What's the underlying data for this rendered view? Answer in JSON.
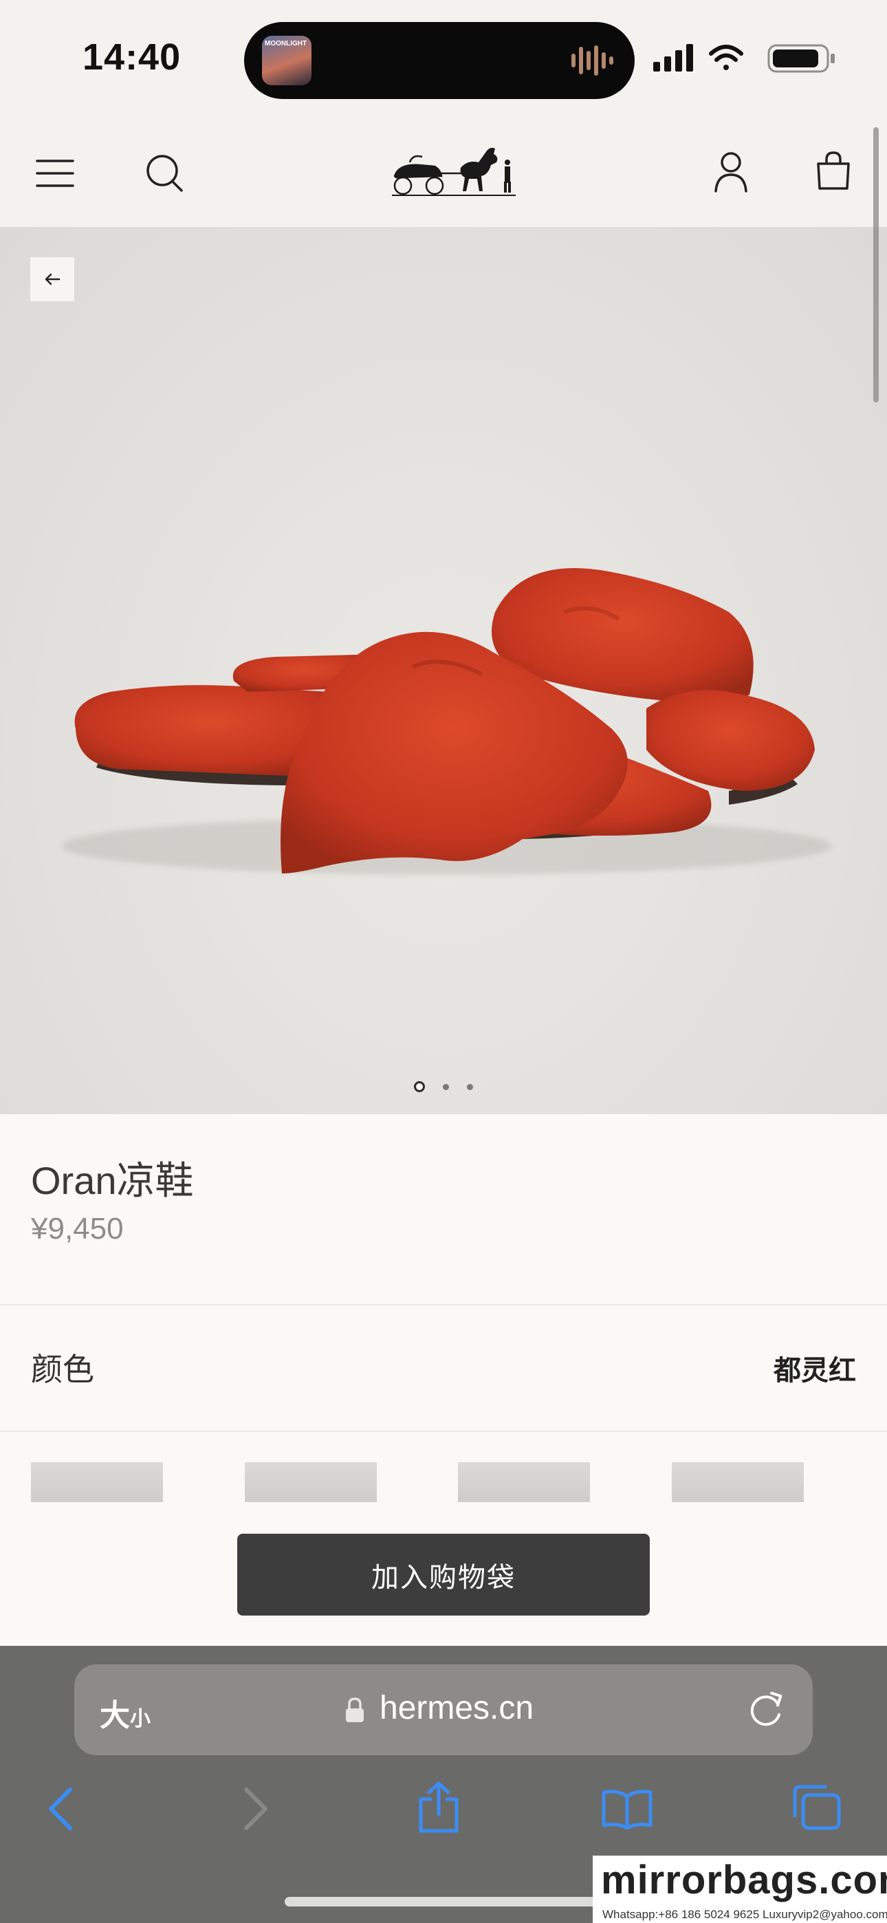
{
  "status_bar": {
    "time": "14:40",
    "now_playing_art_text": "MOONLIGHT"
  },
  "header": {
    "menu_icon": "hamburger-menu-icon",
    "search_icon": "search-icon",
    "logo": "hermes-carriage-logo",
    "account_icon": "account-icon",
    "bag_icon": "shopping-bag-icon"
  },
  "hero": {
    "back_icon": "arrow-left-icon",
    "slides": 3,
    "active_slide": 1
  },
  "product": {
    "name": "Oran凉鞋",
    "price": "¥9,450"
  },
  "color_section": {
    "label": "颜色",
    "value": "都灵红"
  },
  "add_to_bag_label": "加入购物袋",
  "safari": {
    "text_size_label_big": "大",
    "text_size_label_small": "小",
    "url": "hermes.cn"
  },
  "watermark": {
    "logo": "mirrorbags.com",
    "contact": "Whatsapp:+86 186 5024 9625   Luxuryvip2@yahoo.com"
  },
  "colors": {
    "product_red": "#c4361f",
    "header_bg": "#f4f2ef",
    "button_bg": "#3d3d3d",
    "safari_blue": "#3b8df4"
  }
}
